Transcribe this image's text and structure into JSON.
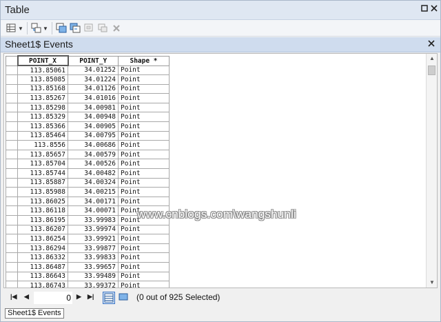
{
  "window": {
    "title": "Table"
  },
  "subtitle": {
    "text": "Sheet1$ Events"
  },
  "table": {
    "columns": [
      "POINT_X",
      "POINT_Y",
      "Shape *"
    ],
    "rows": [
      [
        "113.85061",
        "34.01252",
        "Point"
      ],
      [
        "113.85085",
        "34.01224",
        "Point"
      ],
      [
        "113.85168",
        "34.01126",
        "Point"
      ],
      [
        "113.85267",
        "34.01016",
        "Point"
      ],
      [
        "113.85298",
        "34.00981",
        "Point"
      ],
      [
        "113.85329",
        "34.00948",
        "Point"
      ],
      [
        "113.85366",
        "34.00905",
        "Point"
      ],
      [
        "113.85464",
        "34.00795",
        "Point"
      ],
      [
        "113.8556",
        "34.00686",
        "Point"
      ],
      [
        "113.85657",
        "34.00579",
        "Point"
      ],
      [
        "113.85704",
        "34.00526",
        "Point"
      ],
      [
        "113.85744",
        "34.00482",
        "Point"
      ],
      [
        "113.85887",
        "34.00324",
        "Point"
      ],
      [
        "113.85988",
        "34.00215",
        "Point"
      ],
      [
        "113.86025",
        "34.00171",
        "Point"
      ],
      [
        "113.86118",
        "34.00071",
        "Point"
      ],
      [
        "113.86195",
        "33.99983",
        "Point"
      ],
      [
        "113.86207",
        "33.99974",
        "Point"
      ],
      [
        "113.86254",
        "33.99921",
        "Point"
      ],
      [
        "113.86294",
        "33.99877",
        "Point"
      ],
      [
        "113.86332",
        "33.99833",
        "Point"
      ],
      [
        "113.86487",
        "33.99657",
        "Point"
      ],
      [
        "113.86643",
        "33.99489",
        "Point"
      ],
      [
        "113.86743",
        "33.99372",
        "Point"
      ]
    ]
  },
  "watermark": "www.cnblogs.com\\wangshunli",
  "navigation": {
    "current_record": "0",
    "selection_status": "(0 out of 925 Selected)"
  },
  "bottom_tab": {
    "label": "Sheet1$ Events"
  },
  "icons": {
    "close": "close-icon",
    "table_options": "table-options-icon",
    "related_tables": "related-tables-icon",
    "select_by_attributes": "select-by-attributes-icon",
    "switch_selection": "switch-selection-icon",
    "clear_selection": "clear-selection-icon",
    "zoom_selected": "zoom-selected-icon",
    "delete_selected": "delete-selected-icon"
  }
}
